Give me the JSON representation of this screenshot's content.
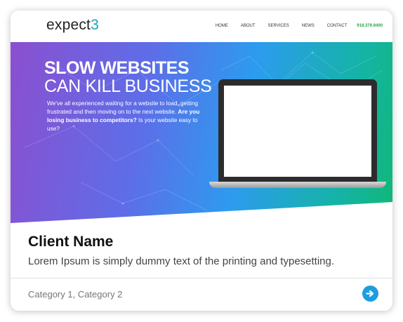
{
  "header": {
    "logo_text": "expect",
    "logo_number": "3",
    "nav": [
      "HOME",
      "ABOUT",
      "SERVICES",
      "NEWS",
      "CONTACT"
    ],
    "phone": "918.379.9400"
  },
  "hero": {
    "title_line1": "SLOW WEBSITES",
    "title_line2": "CAN KILL BUSINESS",
    "body_part1": "We've all experienced  waiting for a website to load, getting frustrated and then moving on to the next website. ",
    "body_bold": "Are you losing business to competitors?",
    "body_part2": " Is your website easy to use?"
  },
  "card": {
    "client_name": "Client Name",
    "description": "Lorem Ipsum is simply dummy text of the printing and typesetting.",
    "categories": "Category 1, Category 2"
  },
  "colors": {
    "accent_blue": "#1a9ee0",
    "logo_teal": "#1aa3b8",
    "phone_green": "#2aa64a"
  },
  "icons": {
    "arrow": "arrow-right-icon"
  }
}
